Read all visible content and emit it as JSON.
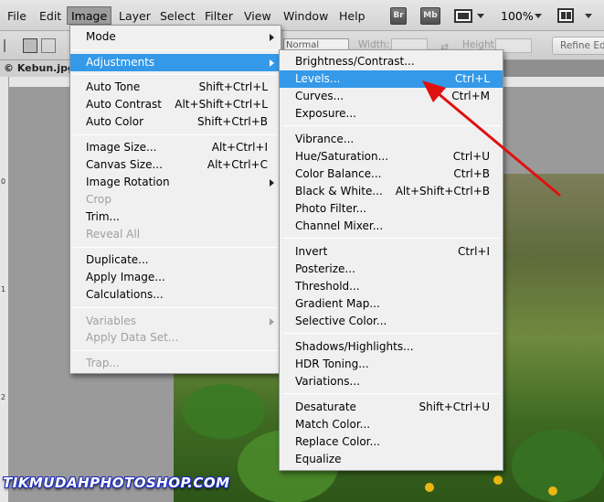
{
  "menubar": {
    "items": [
      "File",
      "Edit",
      "Image",
      "Layer",
      "Select",
      "Filter",
      "View",
      "Window",
      "Help"
    ],
    "active": "Image",
    "buttons": [
      "Br",
      "Mb"
    ],
    "zoom": "100%"
  },
  "optbar": {
    "style_value": "Normal",
    "width_label": "Width:",
    "height_label": "Height:",
    "refine_button": "Refine Edg"
  },
  "document": {
    "tab_title": "© Kebun.jpg",
    "ruler_marks": [
      "0",
      "1",
      "2"
    ]
  },
  "image_menu": {
    "items": [
      {
        "label": "Mode",
        "shortcut": "",
        "submenu": true,
        "disabled": false,
        "highlighted": false
      },
      {
        "label": "Adjustments",
        "shortcut": "",
        "submenu": true,
        "disabled": false,
        "highlighted": true
      },
      {
        "label": "Auto Tone",
        "shortcut": "Shift+Ctrl+L",
        "submenu": false,
        "disabled": false,
        "highlighted": false
      },
      {
        "label": "Auto Contrast",
        "shortcut": "Alt+Shift+Ctrl+L",
        "submenu": false,
        "disabled": false,
        "highlighted": false
      },
      {
        "label": "Auto Color",
        "shortcut": "Shift+Ctrl+B",
        "submenu": false,
        "disabled": false,
        "highlighted": false
      },
      {
        "label": "Image Size...",
        "shortcut": "Alt+Ctrl+I",
        "submenu": false,
        "disabled": false,
        "highlighted": false
      },
      {
        "label": "Canvas Size...",
        "shortcut": "Alt+Ctrl+C",
        "submenu": false,
        "disabled": false,
        "highlighted": false
      },
      {
        "label": "Image Rotation",
        "shortcut": "",
        "submenu": true,
        "disabled": false,
        "highlighted": false
      },
      {
        "label": "Crop",
        "shortcut": "",
        "submenu": false,
        "disabled": true,
        "highlighted": false
      },
      {
        "label": "Trim...",
        "shortcut": "",
        "submenu": false,
        "disabled": false,
        "highlighted": false
      },
      {
        "label": "Reveal All",
        "shortcut": "",
        "submenu": false,
        "disabled": true,
        "highlighted": false
      },
      {
        "label": "Duplicate...",
        "shortcut": "",
        "submenu": false,
        "disabled": false,
        "highlighted": false
      },
      {
        "label": "Apply Image...",
        "shortcut": "",
        "submenu": false,
        "disabled": false,
        "highlighted": false
      },
      {
        "label": "Calculations...",
        "shortcut": "",
        "submenu": false,
        "disabled": false,
        "highlighted": false
      },
      {
        "label": "Variables",
        "shortcut": "",
        "submenu": true,
        "disabled": true,
        "highlighted": false
      },
      {
        "label": "Apply Data Set...",
        "shortcut": "",
        "submenu": false,
        "disabled": true,
        "highlighted": false
      },
      {
        "label": "Trap...",
        "shortcut": "",
        "submenu": false,
        "disabled": true,
        "highlighted": false
      }
    ]
  },
  "adjustments_menu": {
    "items": [
      {
        "label": "Brightness/Contrast...",
        "shortcut": "",
        "highlighted": false
      },
      {
        "label": "Levels...",
        "shortcut": "Ctrl+L",
        "highlighted": true
      },
      {
        "label": "Curves...",
        "shortcut": "Ctrl+M",
        "highlighted": false
      },
      {
        "label": "Exposure...",
        "shortcut": "",
        "highlighted": false
      },
      {
        "label": "Vibrance...",
        "shortcut": "",
        "highlighted": false
      },
      {
        "label": "Hue/Saturation...",
        "shortcut": "Ctrl+U",
        "highlighted": false
      },
      {
        "label": "Color Balance...",
        "shortcut": "Ctrl+B",
        "highlighted": false
      },
      {
        "label": "Black & White...",
        "shortcut": "Alt+Shift+Ctrl+B",
        "highlighted": false
      },
      {
        "label": "Photo Filter...",
        "shortcut": "",
        "highlighted": false
      },
      {
        "label": "Channel Mixer...",
        "shortcut": "",
        "highlighted": false
      },
      {
        "label": "Invert",
        "shortcut": "Ctrl+I",
        "highlighted": false
      },
      {
        "label": "Posterize...",
        "shortcut": "",
        "highlighted": false
      },
      {
        "label": "Threshold...",
        "shortcut": "",
        "highlighted": false
      },
      {
        "label": "Gradient Map...",
        "shortcut": "",
        "highlighted": false
      },
      {
        "label": "Selective Color...",
        "shortcut": "",
        "highlighted": false
      },
      {
        "label": "Shadows/Highlights...",
        "shortcut": "",
        "highlighted": false
      },
      {
        "label": "HDR Toning...",
        "shortcut": "",
        "highlighted": false
      },
      {
        "label": "Variations...",
        "shortcut": "",
        "highlighted": false
      },
      {
        "label": "Desaturate",
        "shortcut": "Shift+Ctrl+U",
        "highlighted": false
      },
      {
        "label": "Match Color...",
        "shortcut": "",
        "highlighted": false
      },
      {
        "label": "Replace Color...",
        "shortcut": "",
        "highlighted": false
      },
      {
        "label": "Equalize",
        "shortcut": "",
        "highlighted": false
      }
    ]
  },
  "watermark": "TIKMUDAHPHOTOSHOP.COM",
  "colors": {
    "highlight": "#3399e8",
    "annotation_arrow": "#e01010"
  }
}
